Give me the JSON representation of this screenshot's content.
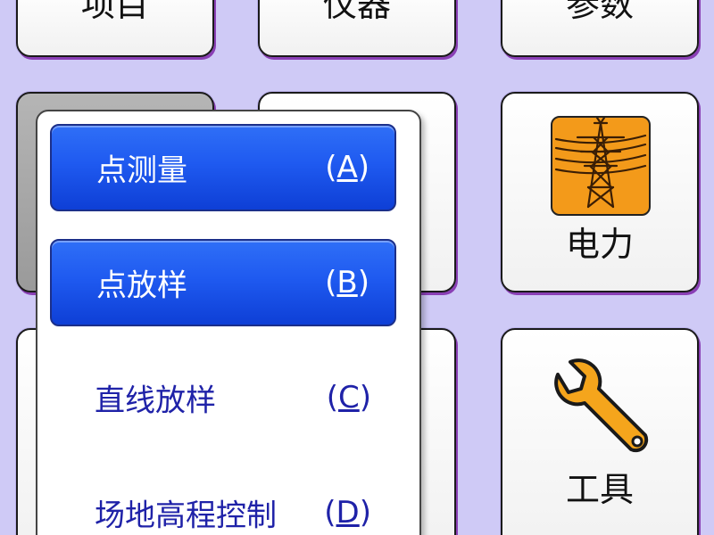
{
  "tiles": {
    "project": "项目",
    "instrument": "仪器",
    "params": "参数",
    "power": "电力",
    "tools": "工具"
  },
  "icons": {
    "power": "power-tower-icon",
    "tools": "wrench-icon"
  },
  "colors": {
    "background": "#cfcaf6",
    "menu_highlight": "#1f5af0",
    "menu_text": "#1f22a8",
    "power_icon_bg": "#f39a1a"
  },
  "menu": {
    "items": [
      {
        "label": "点测量",
        "key_open": "(",
        "key": "A",
        "key_close": ")"
      },
      {
        "label": "点放样",
        "key_open": "(",
        "key": "B",
        "key_close": ")"
      },
      {
        "label": "直线放样",
        "key_open": "(",
        "key": "C",
        "key_close": ")"
      },
      {
        "label": "场地高程控制",
        "key_open": "(",
        "key": "D",
        "key_close": ")"
      }
    ]
  }
}
